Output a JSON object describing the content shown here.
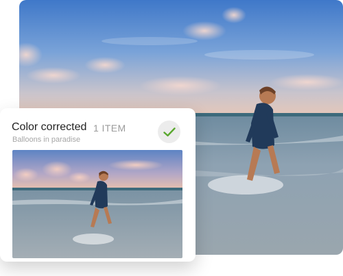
{
  "card": {
    "title": "Color corrected",
    "count": "1 ITEM",
    "subtitle": "Balloons in paradise"
  },
  "icons": {
    "check": "check-icon"
  },
  "colors": {
    "accent_green": "#5aa82f",
    "sky_blue": "#5b8fd0",
    "sea": "#8aa3b5"
  }
}
